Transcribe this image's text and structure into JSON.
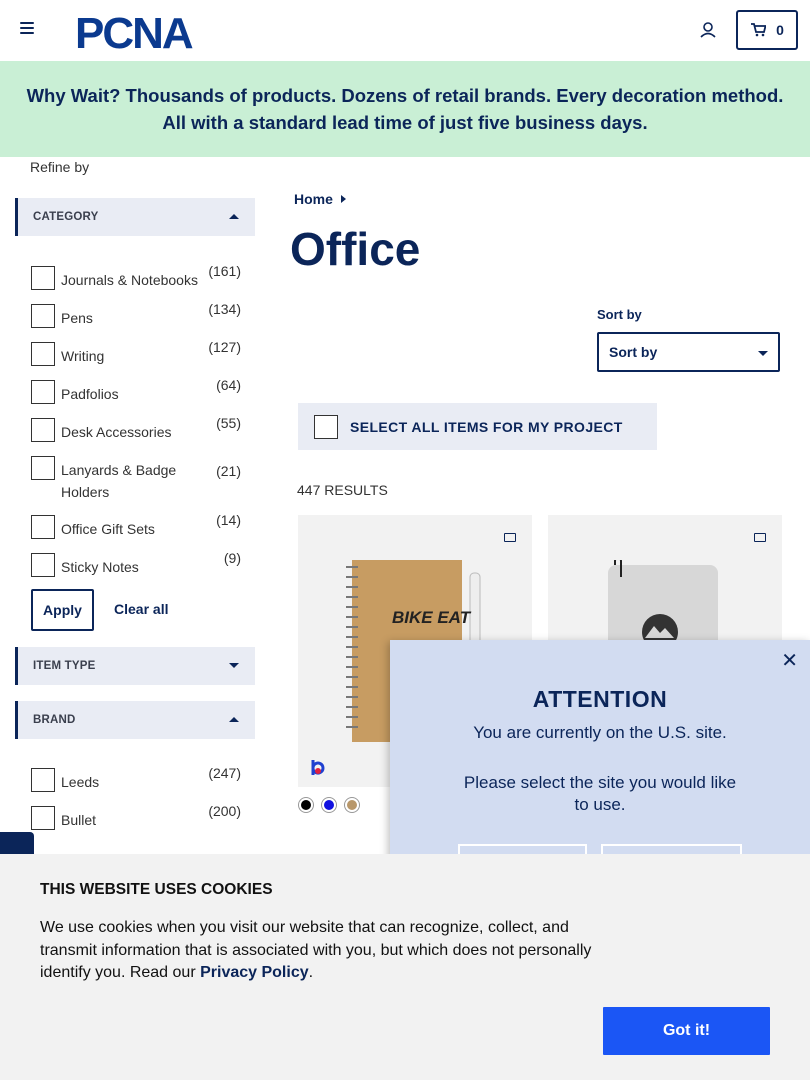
{
  "header": {
    "logo_text": "PCNA",
    "cart_count": "0"
  },
  "banner": {
    "text": "Why Wait? Thousands of products. Dozens of retail brands. Every decoration method. All with a standard lead time of just five business days."
  },
  "sidebar": {
    "refine_label": "Refine by",
    "category_head": "CATEGORY",
    "categories": [
      {
        "label": "Journals & Notebooks",
        "count": "(161)"
      },
      {
        "label": "Pens",
        "count": "(134)"
      },
      {
        "label": "Writing",
        "count": "(127)"
      },
      {
        "label": "Padfolios",
        "count": "(64)"
      },
      {
        "label": "Desk Accessories",
        "count": "(55)"
      },
      {
        "label": "Lanyards & Badge Holders",
        "count": "(21)"
      },
      {
        "label": "Office Gift Sets",
        "count": "(14)"
      },
      {
        "label": "Sticky Notes",
        "count": "(9)"
      }
    ],
    "apply_label": "Apply",
    "clear_label": "Clear all",
    "item_type_head": "ITEM TYPE",
    "brand_head": "BRAND",
    "brands": [
      {
        "label": "Leeds",
        "count": "(247)"
      },
      {
        "label": "Bullet",
        "count": "(200)"
      }
    ]
  },
  "main": {
    "breadcrumb_home": "Home",
    "title": "Office",
    "sort_label": "Sort by",
    "sort_value": "Sort by",
    "select_all_label": "SELECT ALL ITEMS FOR MY PROJECT",
    "results": "447 RESULTS",
    "card1_art_text": "BIKE EAT",
    "swatch_colors": [
      "#000000",
      "#1010e0",
      "#b8976a"
    ]
  },
  "modal": {
    "title": "ATTENTION",
    "line1": "You are currently on the U.S. site.",
    "line2": "Please select the site you would like to use."
  },
  "cookie": {
    "title": "THIS WEBSITE USES COOKIES",
    "body": "We use cookies when you visit our website that can recognize, collect, and transmit information that is associated with you, but which does not personally identify you. Read our ",
    "policy_link": "Privacy Policy",
    "period": ".",
    "button": "Got it!"
  }
}
